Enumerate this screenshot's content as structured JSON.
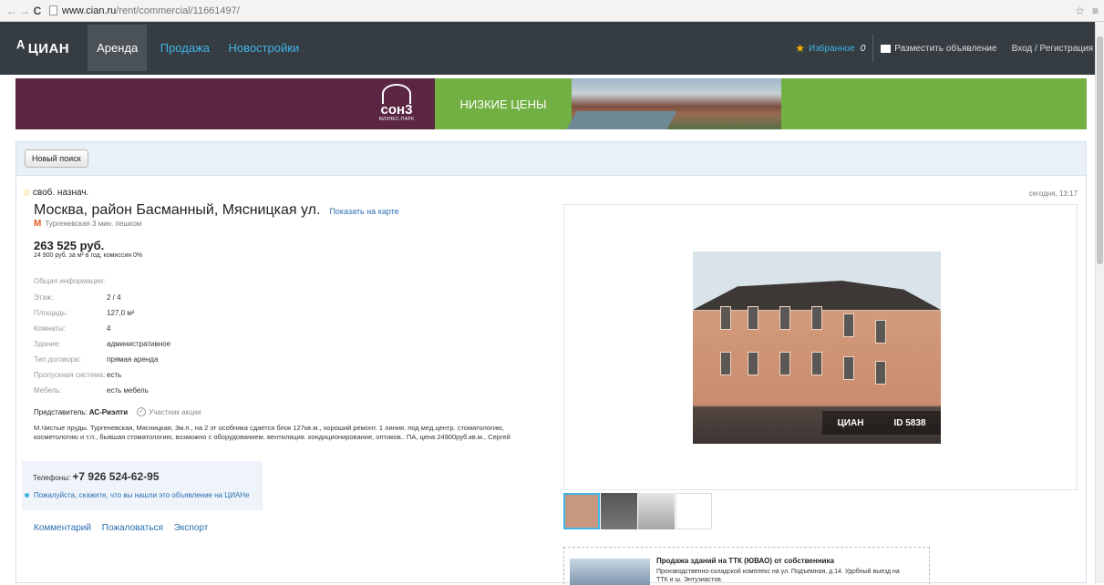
{
  "browser": {
    "back": "←",
    "forward": "→",
    "reload": "C",
    "url_host": "www.cian.ru",
    "url_path": "/rent/commercial/11661497/",
    "star_icon": "☆",
    "menu_icon": "≡"
  },
  "topbar": {
    "logo": "ЦИАН",
    "nav": [
      "Аренда",
      "Продажа",
      "Новостройки"
    ],
    "favorites_label": "Избранное",
    "favorites_count": "0",
    "post_label": "Разместить объявление",
    "login_label": "Вход / Регистрация"
  },
  "banner": {
    "brand": "сон3",
    "brand_sub": "БИЗНЕС-ПАРК",
    "slogan": "НИЗКИЕ ЦЕНЫ"
  },
  "search": {
    "new_search_label": "Новый поиск"
  },
  "listing": {
    "type": "своб. назнач.",
    "timestamp": "сегодня, 13:17",
    "address": "Москва, район Басманный, Мясницкая ул.",
    "show_map": "Показать на карте",
    "metro": "Тургеневская 3 мин. пешком",
    "price": "263 525 руб.",
    "price_details": "24 900 руб. за м² в год, комиссия 0%",
    "info_title": "Общая информация:",
    "info": [
      {
        "k": "Этаж:",
        "v": "2 / 4"
      },
      {
        "k": "Площадь:",
        "v": "127,0 м²"
      },
      {
        "k": "Комнаты:",
        "v": "4"
      },
      {
        "k": "Здание:",
        "v": "административное"
      },
      {
        "k": "Тип договора:",
        "v": "прямая аренда"
      },
      {
        "k": "Пропускная система:",
        "v": "есть"
      },
      {
        "k": "Мебель:",
        "v": "есть мебель"
      }
    ],
    "agent_label": "Представитель:",
    "agent_name": "АС-Риэлти",
    "agent_badge": "Участник акции",
    "description": "М.Чистые пруды. Тургеневская, Мясницкая, 3м.п., на 2 эт особняка сдается блок 127кв.м., хороший ремонт. 1 линия. под мед.центр. стоматологию, косметологию и т.п., бывшая стоматологию, возможно с оборудованием. вентиляция. кондиционирование, оптиков.. ПА, цена 24900руб.кв.м., Сергей",
    "phone_label": "Телефоны:",
    "phone": "+7 926 524-62-95",
    "phone_note": "Пожалуйста, скажите, что вы нашли это объявление на ЦИАНе",
    "actions": [
      "Комментарий",
      "Пожаловаться",
      "Экспорт"
    ],
    "photo_watermark": "ЦИАН",
    "photo_id": "ID 5838"
  },
  "ad": {
    "title": "Продажа зданий на ТТК (ЮВАО) от собственника",
    "text": "Производственно-складской комплекс на ул. Подъемная, д.14. Удобный выезд на ТТК и ш. Энтузиастов."
  }
}
